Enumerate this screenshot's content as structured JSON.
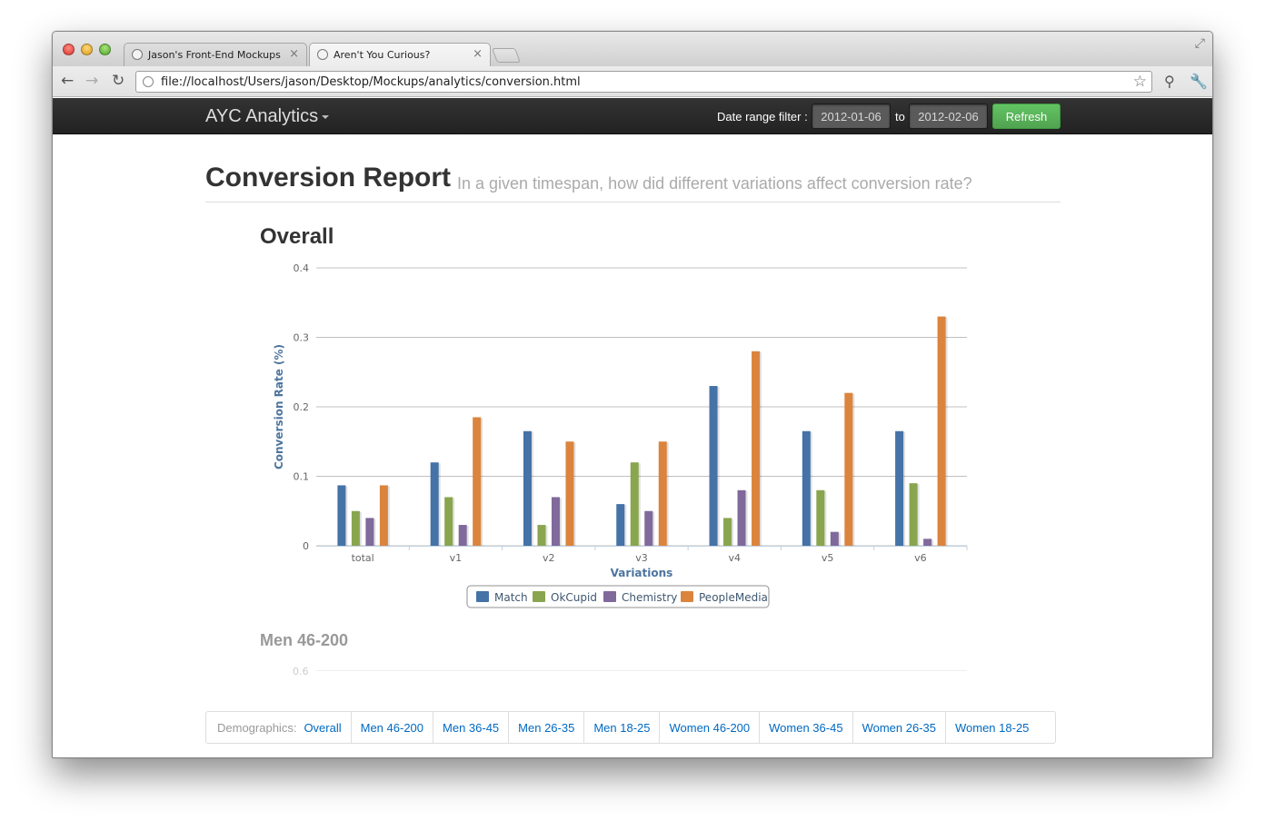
{
  "browser": {
    "tabs": [
      {
        "title": "Jason's Front-End Mockups"
      },
      {
        "title": "Aren't You Curious?"
      }
    ],
    "url": "file://localhost/Users/jason/Desktop/Mockups/analytics/conversion.html",
    "icons": {
      "back": "back-arrow-icon",
      "forward": "forward-arrow-icon",
      "reload": "reload-icon",
      "star": "star-icon",
      "wrench": "wrench-icon"
    }
  },
  "navbar": {
    "brand": "AYC Analytics",
    "filter_label": "Date range filter :",
    "date_from": "2012-01-06",
    "to_label": "to",
    "date_to": "2012-02-06",
    "refresh_label": "Refresh",
    "refresh_color": "#5bb75b"
  },
  "header": {
    "title": "Conversion Report",
    "subtitle": "In a given timespan, how did different variations affect conversion rate?"
  },
  "sections": {
    "overall_title": "Overall",
    "men46_title": "Men 46-200",
    "men46_first_tick": "0.6"
  },
  "chart_data": {
    "type": "bar",
    "categories": [
      "total",
      "v1",
      "v2",
      "v3",
      "v4",
      "v5",
      "v6"
    ],
    "series": [
      {
        "name": "Match",
        "color": "#4572a7",
        "values": [
          0.087,
          0.12,
          0.165,
          0.06,
          0.23,
          0.165,
          0.165
        ]
      },
      {
        "name": "OkCupid",
        "color": "#89a54e",
        "values": [
          0.05,
          0.07,
          0.03,
          0.12,
          0.04,
          0.08,
          0.09
        ]
      },
      {
        "name": "Chemistry",
        "color": "#80699b",
        "values": [
          0.04,
          0.03,
          0.07,
          0.05,
          0.08,
          0.02,
          0.01
        ]
      },
      {
        "name": "PeopleMedia",
        "color": "#db843d",
        "values": [
          0.087,
          0.185,
          0.15,
          0.15,
          0.28,
          0.22,
          0.33
        ]
      }
    ],
    "xlabel": "Variations",
    "ylabel": "Conversion Rate (%)",
    "ylim": [
      0,
      0.4
    ],
    "yticks": [
      "0",
      "0.1",
      "0.2",
      "0.3",
      "0.4"
    ],
    "grid": true,
    "legend": "bottom-center"
  },
  "demographics": {
    "label": "Demographics:",
    "links": [
      "Overall",
      "Men 46-200",
      "Men 36-45",
      "Men 26-35",
      "Men 18-25",
      "Women 46-200",
      "Women 36-45",
      "Women 26-35",
      "Women 18-25"
    ]
  }
}
